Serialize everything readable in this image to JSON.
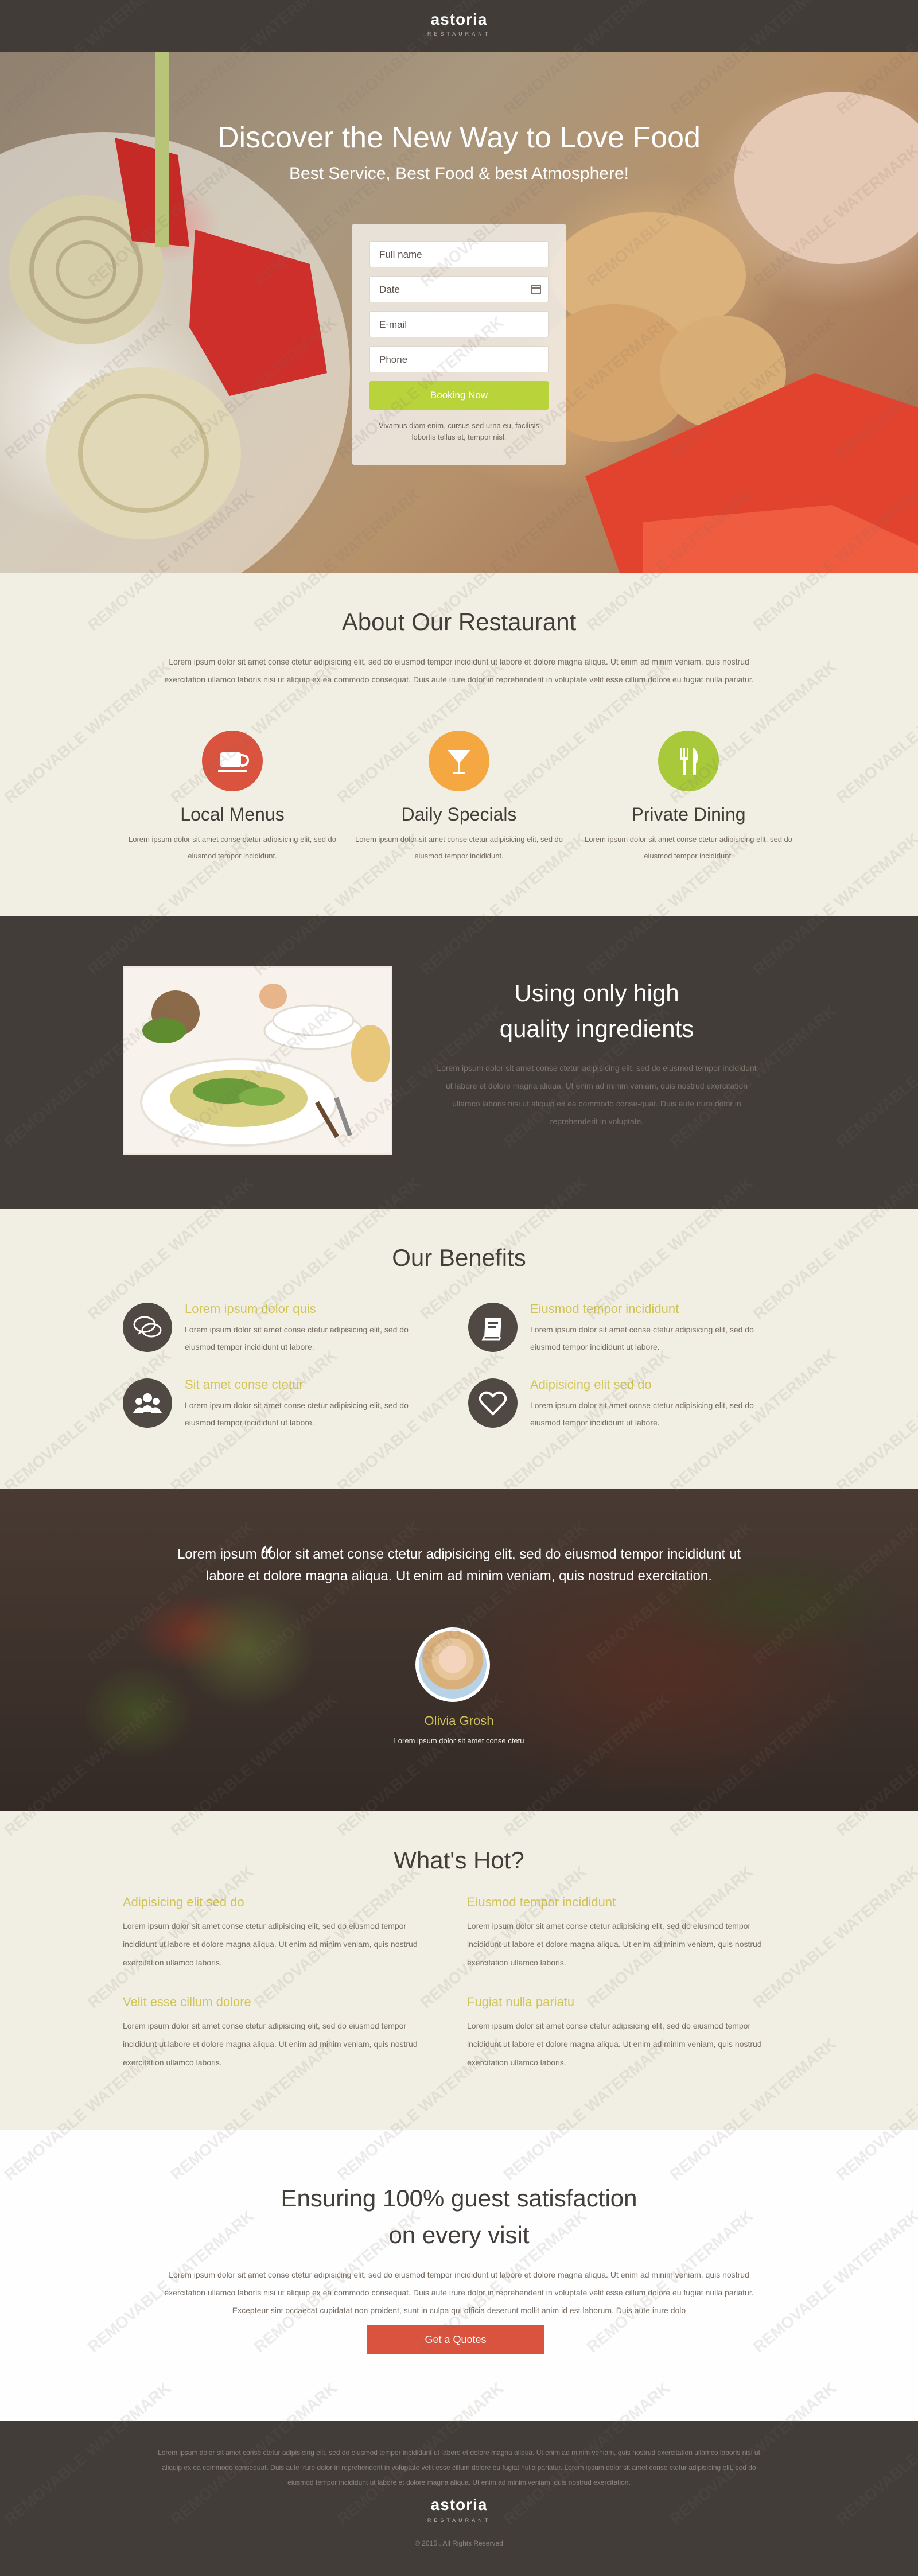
{
  "header": {
    "logo": "astoria",
    "logo_sub": "RESTAURANT"
  },
  "hero": {
    "title": "Discover the New Way to Love Food",
    "subtitle": "Best Service, Best Food & best Atmosphere!",
    "form": {
      "full_name_placeholder": "Full name",
      "date_placeholder": "Date",
      "email_placeholder": "E-mail",
      "phone_placeholder": "Phone",
      "button": "Booking Now",
      "note": "Vivamus diam enim, cursus sed urna eu, facilisis lobortis tellus et, tempor nisl."
    }
  },
  "about": {
    "title": "About Our Restaurant",
    "intro": "Lorem ipsum dolor sit amet conse ctetur adipisicing elit, sed do eiusmod tempor incididunt ut labore et dolore magna aliqua. Ut enim ad minim veniam, quis nostrud exercitation ullamco laboris nisi ut aliquip ex ea commodo consequat. Duis aute irure dolor in reprehenderit in voluptate velit esse cillum dolore eu fugiat nulla pariatur.",
    "features": [
      {
        "icon": "coffee-cup-icon",
        "color": "#d9533e",
        "title": "Local Menus",
        "text": "Lorem ipsum dolor sit amet conse ctetur adipisicing elit, sed do eiusmod tempor incididunt."
      },
      {
        "icon": "cocktail-glass-icon",
        "color": "#f5a742",
        "title": "Daily Specials",
        "text": "Lorem ipsum dolor sit amet conse ctetur adipisicing elit, sed do eiusmod tempor incididunt."
      },
      {
        "icon": "fork-knife-icon",
        "color": "#a8c93a",
        "title": "Private Dining",
        "text": "Lorem ipsum dolor sit amet conse ctetur adipisicing elit, sed do eiusmod tempor incididunt."
      }
    ]
  },
  "ingredients": {
    "title_line1": "Using only high",
    "title_line2": "quality ingredients",
    "text": "Lorem ipsum dolor sit amet conse ctetur adipisicing elit, sed do eiusmod tempor incididunt ut labore et dolore magna aliqua. Ut enim ad minim veniam, quis nostrud exercitation ullamco laboris nisi ut aliquip ex ea commodo conse-quat. Duis aute irure dolor in reprehenderit in voluptate."
  },
  "benefits": {
    "title": "Our Benefits",
    "items": [
      {
        "icon": "chat-bubbles-icon",
        "title": "Lorem ipsum dolor quis",
        "text": "Lorem ipsum dolor sit amet conse ctetur adipisicing elit, sed do eiusmod tempor incididunt ut labore."
      },
      {
        "icon": "book-icon",
        "title": "Eiusmod tempor incididunt",
        "text": "Lorem ipsum dolor sit amet conse ctetur adipisicing elit, sed do eiusmod tempor incididunt ut labore."
      },
      {
        "icon": "users-icon",
        "title": "Sit amet conse ctetur",
        "text": "Lorem ipsum dolor sit amet conse ctetur adipisicing elit, sed do eiusmod tempor incididunt ut labore."
      },
      {
        "icon": "heart-icon",
        "title": "Adipisicing elit sed do",
        "text": "Lorem ipsum dolor sit amet conse ctetur adipisicing elit, sed do eiusmod tempor incididunt ut labore."
      }
    ]
  },
  "testimonial": {
    "quote": "Lorem ipsum dolor sit amet conse ctetur adipisicing elit, sed do eiusmod tempor incididunt ut labore et dolore magna aliqua. Ut enim ad minim veniam, quis nostrud exercitation.",
    "name": "Olivia Grosh",
    "role": "Lorem ipsum dolor sit amet conse ctetu"
  },
  "hot": {
    "title": "What's Hot?",
    "items": [
      {
        "title": "Adipisicing elit sed do",
        "text": "Lorem ipsum dolor sit amet conse ctetur adipisicing elit, sed do eiusmod tempor incididunt ut labore et dolore magna aliqua. Ut enim ad minim veniam, quis nostrud exercitation ullamco laboris."
      },
      {
        "title": "Eiusmod tempor incididunt",
        "text": "Lorem ipsum dolor sit amet conse ctetur adipisicing elit, sed do eiusmod tempor incididunt ut labore et dolore magna aliqua. Ut enim ad minim veniam, quis nostrud exercitation ullamco laboris."
      },
      {
        "title": "Velit esse cillum dolore",
        "text": "Lorem ipsum dolor sit amet conse ctetur adipisicing elit, sed do eiusmod tempor incididunt ut labore et dolore magna aliqua. Ut enim ad minim veniam, quis nostrud exercitation ullamco laboris."
      },
      {
        "title": "Fugiat nulla pariatu",
        "text": "Lorem ipsum dolor sit amet conse ctetur adipisicing elit, sed do eiusmod tempor incididunt ut labore et dolore magna aliqua. Ut enim ad minim veniam, quis nostrud exercitation ullamco laboris."
      }
    ]
  },
  "satisfaction": {
    "title_line1": "Ensuring 100% guest satisfaction",
    "title_line2": "on every visit",
    "text": "Lorem ipsum dolor sit amet conse ctetur adipisicing elit, sed do eiusmod tempor incididunt ut labore et dolore magna aliqua. Ut enim ad minim veniam, quis nostrud exercitation ullamco laboris nisi ut aliquip ex ea commodo consequat. Duis aute irure dolor in reprehenderit in voluptate velit esse cillum dolore eu fugiat nulla pariatur. Excepteur sint occaecat cupidatat non proident, sunt in culpa qui officia deserunt mollit anim id est laborum. Duis aute irure dolo",
    "button": "Get a Quotes"
  },
  "footer": {
    "text": "Lorem ipsum dolor sit amet conse ctetur adipisicing elit, sed do eiusmod tempor incididunt ut labore et dolore magna aliqua. Ut enim ad minim veniam, quis nostrud exercitation ullamco laboris nisi ut aliquip ex ea commodo consequat. Duis aute irure dolor in reprehenderit in voluptate velit esse cillum dolore eu fugiat nulla pariatur. Lorem ipsum dolor sit amet conse ctetur adipisicing elit, sed do eiusmod tempor incididunt ut labore et dolore magna aliqua. Ut enim ad minim veniam, quis nostrud exercitation.",
    "logo": "astoria",
    "logo_sub": "RESTAURANT",
    "copyright": "© 2015 . All Rights Reserved"
  },
  "watermark": "REMOVABLE WATERMARK"
}
